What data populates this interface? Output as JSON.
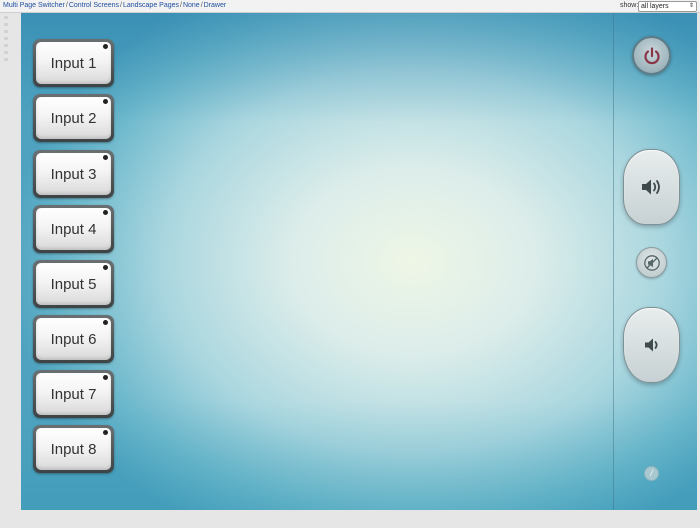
{
  "topbar": {
    "breadcrumb": [
      "Multi Page Switcher",
      "Control Screens",
      "Landscape Pages",
      "None",
      "Drawer"
    ],
    "show_label": "show:",
    "layer_select": {
      "value": "all layers"
    }
  },
  "inputs": [
    {
      "label": "Input 1"
    },
    {
      "label": "Input 2"
    },
    {
      "label": "Input 3"
    },
    {
      "label": "Input 4"
    },
    {
      "label": "Input 5"
    },
    {
      "label": "Input 6"
    },
    {
      "label": "Input 7"
    },
    {
      "label": "Input 8"
    }
  ],
  "controls": {
    "power_icon": "power-icon",
    "volume_up_icon": "speaker-loud-icon",
    "mute_icon": "speaker-muted-icon",
    "volume_down_icon": "speaker-quiet-icon",
    "info_label": "/"
  },
  "colors": {
    "breadcrumb_link": "#1f4fa0",
    "power_accent": "#8a3548",
    "icon_gray": "#3f4a4d"
  }
}
